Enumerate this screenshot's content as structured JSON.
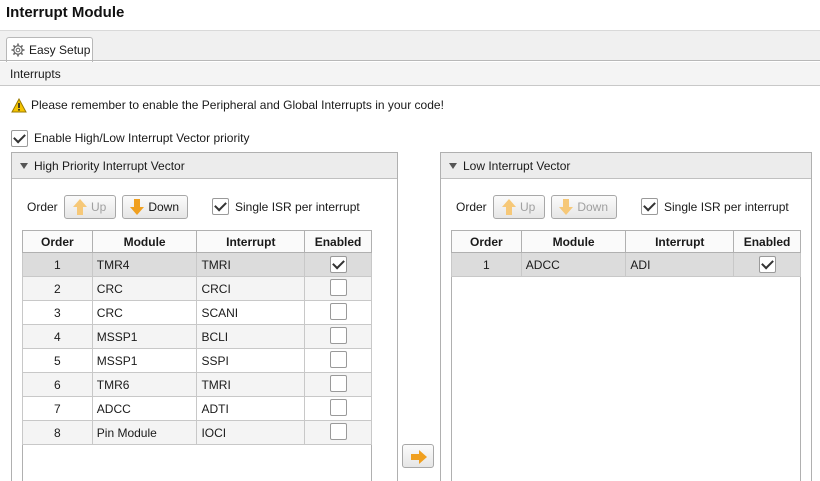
{
  "title": "Interrupt Module",
  "tab": {
    "label": "Easy Setup"
  },
  "section": {
    "label": "Interrupts"
  },
  "warning": {
    "text": "Please remember to enable the Peripheral and Global Interrupts in your code!"
  },
  "enable_priority": {
    "label": "Enable High/Low Interrupt Vector priority",
    "checked": true
  },
  "high_panel": {
    "title": "High Priority Interrupt Vector",
    "order_label": "Order",
    "up_label": "Up",
    "down_label": "Down",
    "single_isr_label": "Single ISR per interrupt",
    "single_isr_checked": true,
    "columns": [
      "Order",
      "Module",
      "Interrupt",
      "Enabled"
    ],
    "rows": [
      {
        "order": "1",
        "module": "TMR4",
        "interrupt": "TMRI",
        "enabled": true
      },
      {
        "order": "2",
        "module": "CRC",
        "interrupt": "CRCI",
        "enabled": false
      },
      {
        "order": "3",
        "module": "CRC",
        "interrupt": "SCANI",
        "enabled": false
      },
      {
        "order": "4",
        "module": "MSSP1",
        "interrupt": "BCLI",
        "enabled": false
      },
      {
        "order": "5",
        "module": "MSSP1",
        "interrupt": "SSPI",
        "enabled": false
      },
      {
        "order": "6",
        "module": "TMR6",
        "interrupt": "TMRI",
        "enabled": false
      },
      {
        "order": "7",
        "module": "ADCC",
        "interrupt": "ADTI",
        "enabled": false
      },
      {
        "order": "8",
        "module": "Pin Module",
        "interrupt": "IOCI",
        "enabled": false
      }
    ]
  },
  "low_panel": {
    "title": "Low Interrupt Vector",
    "order_label": "Order",
    "up_label": "Up",
    "down_label": "Down",
    "single_isr_label": "Single ISR per interrupt",
    "single_isr_checked": true,
    "columns": [
      "Order",
      "Module",
      "Interrupt",
      "Enabled"
    ],
    "rows": [
      {
        "order": "1",
        "module": "ADCC",
        "interrupt": "ADI",
        "enabled": true
      }
    ]
  },
  "icons": {
    "tab": "gear-icon",
    "warning": "warning-icon",
    "collapse": "collapse-triangle-icon",
    "up": "arrow-up-icon",
    "down": "arrow-down-icon",
    "transfer": "arrow-right-icon"
  },
  "colors": {
    "arrow": "#f0a020",
    "warning": "#f5c400"
  }
}
